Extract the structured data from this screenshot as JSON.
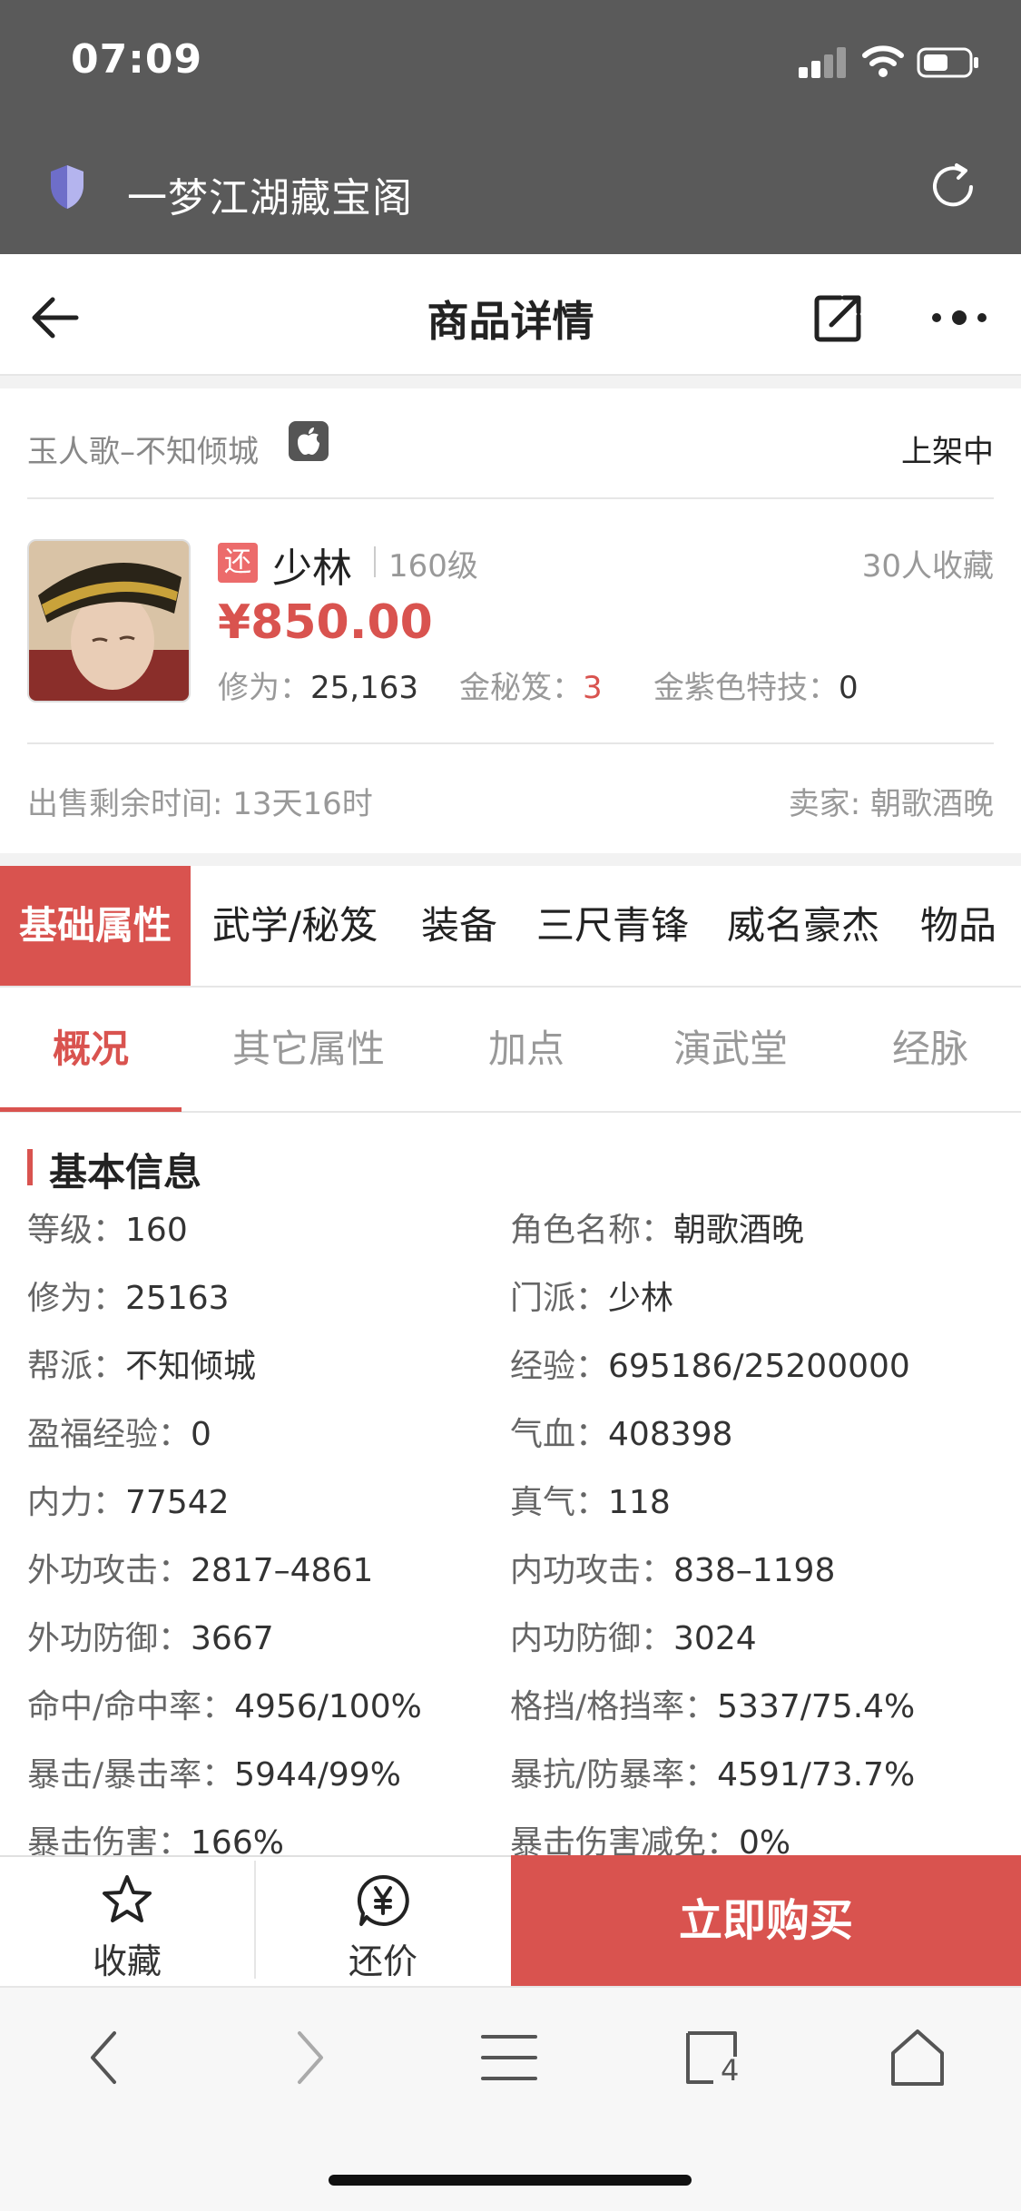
{
  "status_bar": {
    "time": "07:09"
  },
  "browser": {
    "site_title": "一梦江湖藏宝阁"
  },
  "header": {
    "title": "商品详情"
  },
  "item": {
    "server": "玉人歌–不知倾城",
    "status": "上架中",
    "tag": "还",
    "sect": "少林",
    "level": "160级",
    "favorites": "30人收藏",
    "price": "¥850.00",
    "meta": [
      {
        "label": "修为：",
        "value": "25,163"
      },
      {
        "label": "金秘笈：",
        "value": "3"
      },
      {
        "label": "金紫色特技：",
        "value": "0"
      }
    ],
    "remaining_time": "出售剩余时间: 13天16时",
    "seller": "卖家: 朝歌酒晚"
  },
  "category_tabs": [
    "基础属性",
    "武学/秘笈",
    "装备",
    "三尺青锋",
    "威名豪杰",
    "物品"
  ],
  "sub_tabs": [
    "概况",
    "其它属性",
    "加点",
    "演武堂",
    "经脉"
  ],
  "basic_info": {
    "title": "基本信息",
    "rows": [
      [
        {
          "label": "等级：",
          "value": "160"
        },
        {
          "label": "角色名称：",
          "value": "朝歌酒晚"
        }
      ],
      [
        {
          "label": "修为：",
          "value": "25163"
        },
        {
          "label": "门派：",
          "value": "少林"
        }
      ],
      [
        {
          "label": "帮派：",
          "value": "不知倾城"
        },
        {
          "label": "经验：",
          "value": "695186/25200000"
        }
      ],
      [
        {
          "label": "盈福经验：",
          "value": "0"
        },
        {
          "label": "气血：",
          "value": "408398"
        }
      ],
      [
        {
          "label": "内力：",
          "value": "77542"
        },
        {
          "label": "真气：",
          "value": "118"
        }
      ],
      [
        {
          "label": "外功攻击：",
          "value": "2817–4861"
        },
        {
          "label": "内功攻击：",
          "value": "838–1198"
        }
      ],
      [
        {
          "label": "外功防御：",
          "value": "3667"
        },
        {
          "label": "内功防御：",
          "value": "3024"
        }
      ],
      [
        {
          "label": "命中/命中率：",
          "value": "4956/100%"
        },
        {
          "label": "格挡/格挡率：",
          "value": "5337/75.4%"
        }
      ],
      [
        {
          "label": "暴击/暴击率：",
          "value": "5944/99%"
        },
        {
          "label": "暴抗/防暴率：",
          "value": "4591/73.7%"
        }
      ],
      [
        {
          "label": "暴击伤害：",
          "value": "166%"
        },
        {
          "label": "暴击伤害减免：",
          "value": "0%"
        }
      ]
    ]
  },
  "actions": {
    "favorite": "收藏",
    "bargain": "还价",
    "buy": "立即购买"
  },
  "toolbar": {
    "tabs_count": "4"
  },
  "colors": {
    "accent": "#d9534f",
    "status_bg": "#5a5a5a"
  },
  "icons": [
    "shield-icon",
    "reload-icon",
    "back-arrow-icon",
    "share-icon",
    "more-icon",
    "apple-icon",
    "star-icon",
    "yen-bubble-icon",
    "chevron-left-icon",
    "chevron-right-icon",
    "menu-icon",
    "tabs-icon",
    "home-icon"
  ]
}
